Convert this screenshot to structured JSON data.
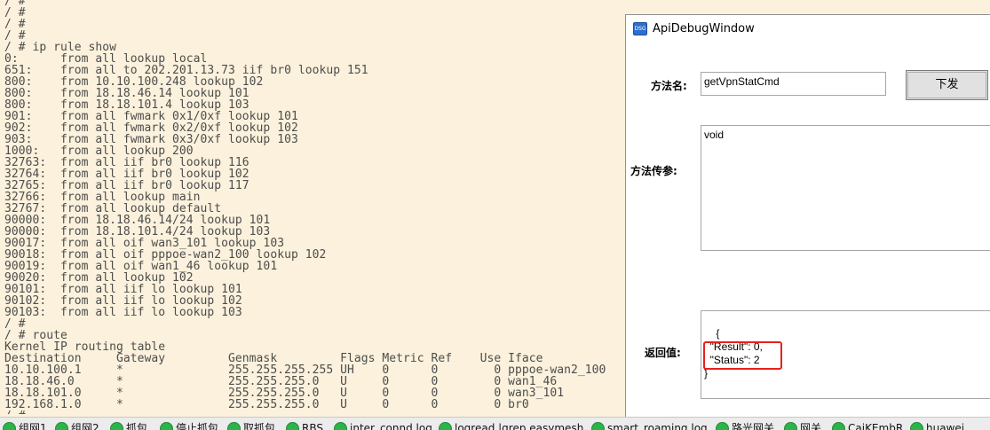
{
  "terminal": {
    "lines": [
      "/ #",
      "/ #",
      "/ #",
      "/ #",
      "/ # ip rule show",
      "0:      from all lookup local",
      "651:    from all to 202.201.13.73 iif br0 lookup 151",
      "800:    from 10.10.100.248 lookup 102",
      "800:    from 18.18.46.14 lookup 101",
      "800:    from 18.18.101.4 lookup 103",
      "901:    from all fwmark 0x1/0xf lookup 101",
      "902:    from all fwmark 0x2/0xf lookup 102",
      "903:    from all fwmark 0x3/0xf lookup 103",
      "1000:   from all lookup 200",
      "32763:  from all iif br0 lookup 116",
      "32764:  from all iif br0 lookup 102",
      "32765:  from all iif br0 lookup 117",
      "32766:  from all lookup main",
      "32767:  from all lookup default",
      "90000:  from 18.18.46.14/24 lookup 101",
      "90000:  from 18.18.101.4/24 lookup 103",
      "90017:  from all oif wan3_101 lookup 103",
      "90018:  from all oif pppoe-wan2_100 lookup 102",
      "90019:  from all oif wan1_46 lookup 101",
      "90020:  from all lookup 102",
      "90101:  from all iif lo lookup 101",
      "90102:  from all iif lo lookup 102",
      "90103:  from all iif lo lookup 103",
      "/ #",
      "/ # route",
      "Kernel IP routing table",
      "Destination     Gateway         Genmask         Flags Metric Ref    Use Iface",
      "10.10.100.1     *               255.255.255.255 UH    0      0        0 pppoe-wan2_100",
      "18.18.46.0      *               255.255.255.0   U     0      0        0 wan1_46",
      "18.18.101.0     *               255.255.255.0   U     0      0        0 wan3_101",
      "192.168.1.0     *               255.255.255.0   U     0      0        0 br0",
      "/ #"
    ]
  },
  "debug_window": {
    "app_icon_text": "DSG",
    "title": "ApiDebugWindow",
    "method_name_label": "方法名:",
    "method_name_value": "getVpnStatCmd",
    "send_button_label": "下发",
    "params_label": "方法传参:",
    "params_value": "void",
    "return_label": "返回值:",
    "return_value": "{\n  \"Result\": 0,\n  \"Status\": 2\n}",
    "highlight_color": "#e8201c"
  },
  "taskbar": {
    "dot_color": "#2cb34a",
    "items": [
      "组网1",
      "组网2",
      "抓包",
      "停止抓包",
      "取抓包",
      "RBS",
      "inter_connd.log",
      "logread |grep easymesh",
      "smart_roaming.log",
      "路光网关",
      "网关",
      "CaiKEmbR",
      "huawei"
    ]
  }
}
